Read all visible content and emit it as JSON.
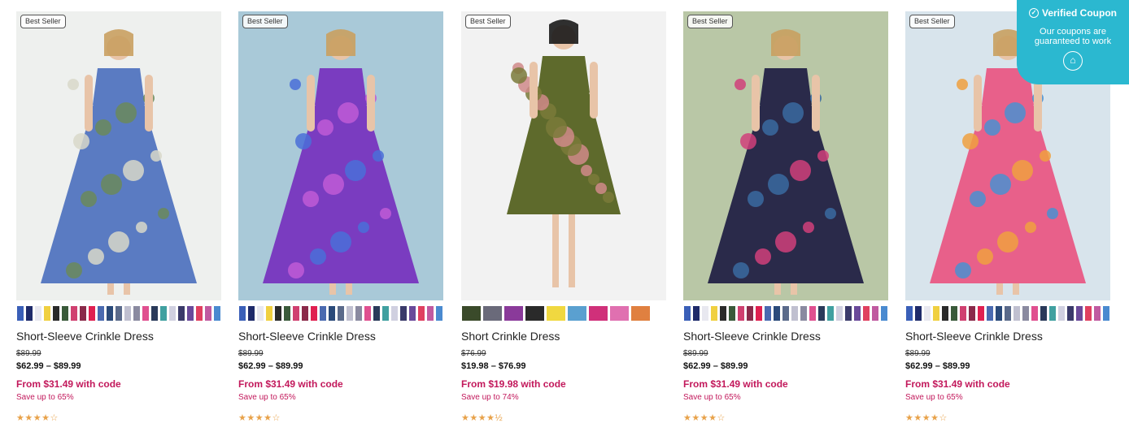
{
  "products": [
    {
      "badge": "Best Seller",
      "title": "Short-Sleeve Crinkle Dress",
      "was": "$89.99",
      "now": "$62.99 – $89.99",
      "promo": "From $31.49 with code",
      "save": "Save up to 65%",
      "stars": "★★★★☆",
      "rating": 4,
      "bg": "#eef0ee",
      "dress": [
        "#5a7bc2",
        "#d8d8c9",
        "#6b8a5a"
      ]
    },
    {
      "badge": "Best Seller",
      "title": "Short-Sleeve Crinkle Dress",
      "was": "$89.99",
      "now": "$62.99 – $89.99",
      "promo": "From $31.49 with code",
      "save": "Save up to 65%",
      "stars": "★★★★☆",
      "rating": 4,
      "bg": "#a9c9d8",
      "dress": [
        "#7a3cc0",
        "#4a6fd8",
        "#c05ad6"
      ]
    },
    {
      "badge": "Best Seller",
      "title": "Short Crinkle Dress",
      "was": "$76.99",
      "now": "$19.98 – $76.99",
      "promo": "From $19.98 with code",
      "save": "Save up to 74%",
      "stars": "★★★★½",
      "rating": 4.5,
      "bg": "#f2f2f2",
      "dress": [
        "#5e6a2c",
        "#d08a8a",
        "#7a7a3a"
      ]
    },
    {
      "badge": "Best Seller",
      "title": "Short-Sleeve Crinkle Dress",
      "was": "$89.99",
      "now": "$62.99 – $89.99",
      "promo": "From $31.49 with code",
      "save": "Save up to 65%",
      "stars": "★★★★☆",
      "rating": 4,
      "bg": "#b9c7a6",
      "dress": [
        "#2a2a4a",
        "#d0407a",
        "#3a6aa0"
      ]
    },
    {
      "badge": "Best Seller",
      "title": "Short-Sleeve Crinkle Dress",
      "was": "$89.99",
      "now": "$62.99 – $89.99",
      "promo": "From $31.49 with code",
      "save": "Save up to 65%",
      "stars": "★★★★☆",
      "rating": 4,
      "bg": "#d8e4ec",
      "dress": [
        "#e8608a",
        "#f0a040",
        "#4a90d0"
      ]
    }
  ],
  "swatch_colors_a": [
    "#3a5fb8",
    "#1e2a6a",
    "#e8e8f0",
    "#f0d040",
    "#2a2a2a",
    "#3a5a3a",
    "#d04070",
    "#8a2a4a",
    "#e02050",
    "#4a6ab0",
    "#2a4a7a",
    "#5a6a8a",
    "#c0c0d0",
    "#8a8aa0",
    "#e05090",
    "#2a3a5a",
    "#40a0a0",
    "#d0d0e0",
    "#3a3a6a",
    "#6a4a9a",
    "#e04060",
    "#c05aa0",
    "#4a8ad0",
    "#3a4a8a",
    "#8a9ab0",
    "#2a6a9a"
  ],
  "swatch_colors_c": [
    "#3a4a2a",
    "#6a6a7a",
    "#8a3a9a",
    "#2a2a2a",
    "#f0d840",
    "#5aa0d0",
    "#d0307a",
    "#e070b0",
    "#e08040"
  ],
  "coupon": {
    "title": "Verified Coupon",
    "subtitle_line1": "Our coupons are",
    "subtitle_line2": "guaranteed to work",
    "bg": "#2bb8d0"
  }
}
